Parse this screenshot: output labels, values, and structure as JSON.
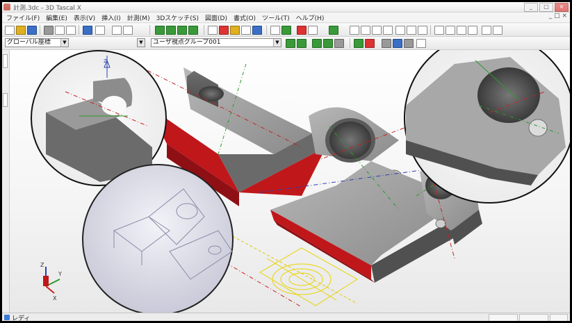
{
  "window": {
    "title": "計測.3dc - 3D Tascal X",
    "minimize_glyph": "_",
    "maximize_glyph": "□",
    "close_glyph": "×"
  },
  "menu": [
    {
      "label": "ファイル(F)"
    },
    {
      "label": "編集(E)"
    },
    {
      "label": "表示(V)"
    },
    {
      "label": "挿入(I)"
    },
    {
      "label": "計測(M)"
    },
    {
      "label": "3Dスケッチ(S)"
    },
    {
      "label": "図面(D)"
    },
    {
      "label": "書式(O)"
    },
    {
      "label": "ツール(T)"
    },
    {
      "label": "ヘルプ(H)"
    }
  ],
  "menu_ctrl": "_ □ ×",
  "toolbar": {
    "coord_combo": "グローバル座標",
    "view_group_combo": "ユーザ視点グループ001",
    "combo_arrow": "▼"
  },
  "axes": {
    "x_label": "X",
    "y_label": "Y",
    "z_label": "Z"
  },
  "statusbar": {
    "text": "レディ"
  },
  "colors": {
    "accent": "#2a4fa8",
    "part_face": "#707070",
    "cut_face": "#c0171b",
    "sketch": "#e8d400"
  },
  "icons": [
    "new-file-icon",
    "open-file-icon",
    "save-icon",
    "cut-icon",
    "copy-icon",
    "paste-icon",
    "undo-icon",
    "redo-icon",
    "delete-icon",
    "measure-icon",
    "view-icon",
    "rotate-icon",
    "zoom-icon"
  ]
}
